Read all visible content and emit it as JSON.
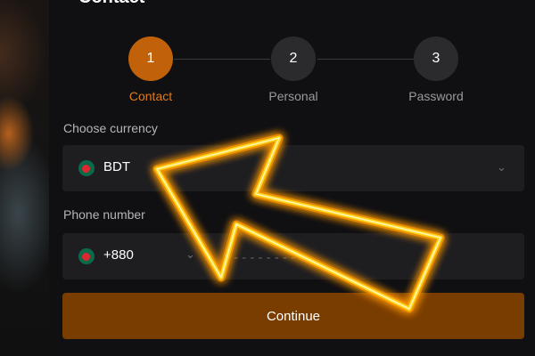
{
  "panel": {
    "title": "Contact"
  },
  "steps": [
    {
      "number": "1",
      "label": "Contact",
      "active": true
    },
    {
      "number": "2",
      "label": "Personal",
      "active": false
    },
    {
      "number": "3",
      "label": "Password",
      "active": false
    }
  ],
  "currency": {
    "label": "Choose currency",
    "value": "BDT"
  },
  "phone": {
    "label": "Phone number",
    "code": "+880",
    "placeholder": "- - - - - - - - - -"
  },
  "continue_label": "Continue",
  "colors": {
    "accent": "#c1620a",
    "button": "#7a3d00",
    "glow": "#ffd21a"
  }
}
